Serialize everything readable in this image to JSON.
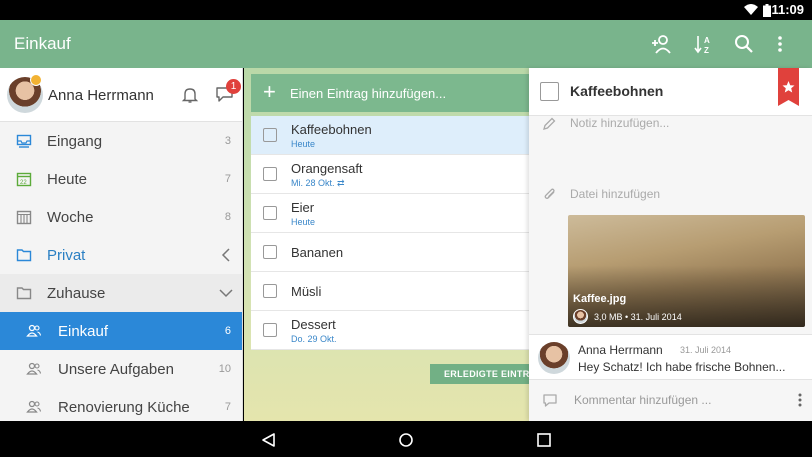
{
  "status_bar": {
    "time": "11:09"
  },
  "app_bar": {
    "title": "Einkauf",
    "actions": [
      "add-person-icon",
      "sort-az-icon",
      "search-icon",
      "more-vert-icon"
    ],
    "color": "#79b48c"
  },
  "user": {
    "name": "Anna Herrmann",
    "chat_count": "1"
  },
  "sidebar": {
    "items": [
      {
        "label": "Eingang",
        "count": "3",
        "icon": "inbox-icon"
      },
      {
        "label": "Heute",
        "count": "7",
        "icon": "calendar-today-icon"
      },
      {
        "label": "Woche",
        "count": "8",
        "icon": "calendar-week-icon"
      },
      {
        "label": "Privat",
        "count": "",
        "icon": "folder-icon"
      },
      {
        "label": "Zuhause",
        "count": "",
        "icon": "folder-icon"
      },
      {
        "label": "Einkauf",
        "count": "6",
        "icon": "shared-list-icon"
      },
      {
        "label": "Unsere Aufgaben",
        "count": "10",
        "icon": "shared-list-icon"
      },
      {
        "label": "Renovierung Küche",
        "count": "7",
        "icon": "shared-list-icon"
      }
    ],
    "active_color": "#2b88d8"
  },
  "add_item": {
    "placeholder": "Einen Eintrag hinzufügen..."
  },
  "tasks": [
    {
      "title": "Kaffeebohnen",
      "date": "Heute",
      "selected": true
    },
    {
      "title": "Orangensaft",
      "date": "Mi. 28 Okt. ⇄"
    },
    {
      "title": "Eier",
      "date": "Heute"
    },
    {
      "title": "Bananen",
      "date": ""
    },
    {
      "title": "Müsli",
      "date": ""
    },
    {
      "title": "Dessert",
      "date": "Do. 29 Okt."
    }
  ],
  "done_button": {
    "label": "ERLEDIGTE EINTR"
  },
  "detail": {
    "title": "Kaffeebohnen",
    "note_placeholder": "Notiz hinzufügen...",
    "file_label": "Datei hinzufügen",
    "attachment": {
      "name": "Kaffee.jpg",
      "meta": "3,0 MB • 31. Juli 2014"
    },
    "comment": {
      "author": "Anna Herrmann",
      "date": "31. Juli 2014",
      "text": "Hey Schatz! Ich habe frische Bohnen..."
    },
    "comment_placeholder": "Kommentar hinzufügen ...",
    "ribbon_color": "#e0413c"
  }
}
